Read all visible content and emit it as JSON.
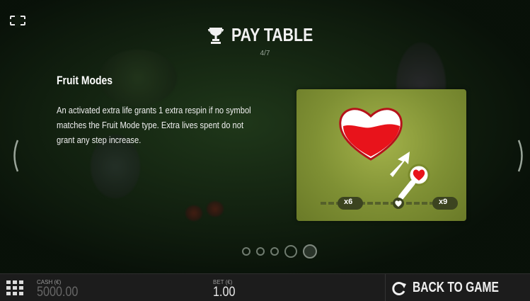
{
  "header": {
    "title": "PAY TABLE",
    "page_indicator": "4/7"
  },
  "content": {
    "section_title": "Fruit Modes",
    "description": "An activated extra life grants 1 extra respin if no symbol matches the Fruit Mode type. Extra lives spent do not grant any step increase."
  },
  "illustration": {
    "multiplier_left": "x6",
    "multiplier_right": "x9"
  },
  "pagination": {
    "total": 5,
    "active_index": 3
  },
  "footer": {
    "cash_label": "CASH (€)",
    "cash_value": "5000.00",
    "bet_label": "BET (€)",
    "bet_value": "1.00",
    "back_label": "BACK TO GAME"
  },
  "icons": {
    "fullscreen": "fullscreen-icon",
    "trophy": "trophy-icon",
    "menu": "grid-menu-icon",
    "back": "refresh-arrow-icon",
    "prev": "chevron-left-icon",
    "next": "chevron-right-icon"
  },
  "colors": {
    "card_green": "#8a9a3a",
    "heart_red": "#e8131b",
    "footer_bg": "#1c1c1c"
  }
}
